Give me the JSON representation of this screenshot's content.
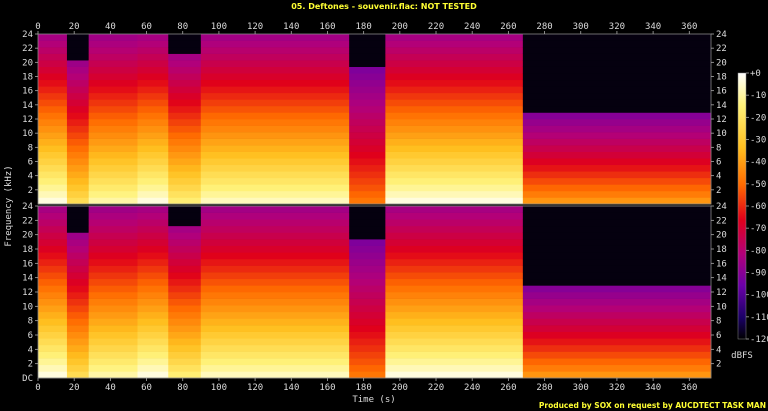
{
  "title": "05. Deftones - souvenir.flac: NOT TESTED",
  "credit": "Produced by SOX on request by AUCDTECT TASK MAN",
  "chart_data": {
    "type": "heatmap",
    "title": "05. Deftones - souvenir.flac: NOT TESTED",
    "xlabel": "Time (s)",
    "ylabel": "Frequency (kHz)",
    "xlim": [
      0,
      372
    ],
    "ylim": [
      0,
      24
    ],
    "x_ticks": [
      0,
      20,
      40,
      60,
      80,
      100,
      120,
      140,
      160,
      180,
      200,
      220,
      240,
      260,
      280,
      300,
      320,
      340,
      360
    ],
    "y_ticks": [
      2,
      4,
      6,
      8,
      10,
      12,
      14,
      16,
      18,
      20,
      22,
      24
    ],
    "y_tick_labels_left": [
      "DC",
      "2",
      "4",
      "6",
      "8",
      "10",
      "12",
      "14",
      "16",
      "18",
      "20",
      "22",
      "24"
    ],
    "channels": [
      "upper",
      "lower"
    ],
    "colorbar": {
      "label": "dBFS",
      "ticks": [
        "+0",
        "-10",
        "-20",
        "-30",
        "-40",
        "-50",
        "-60",
        "-70",
        "-80",
        "-90",
        "-100",
        "-110",
        "-120"
      ]
    },
    "segments": [
      {
        "start": 0,
        "end": 16,
        "cutoff_khz": 24,
        "level": 0.85
      },
      {
        "start": 16,
        "end": 28,
        "cutoff_khz": 21,
        "level": 0.7
      },
      {
        "start": 28,
        "end": 55,
        "cutoff_khz": 24,
        "level": 0.8
      },
      {
        "start": 55,
        "end": 72,
        "cutoff_khz": 24,
        "level": 0.85
      },
      {
        "start": 72,
        "end": 90,
        "cutoff_khz": 22,
        "level": 0.75
      },
      {
        "start": 90,
        "end": 172,
        "cutoff_khz": 24,
        "level": 0.82
      },
      {
        "start": 172,
        "end": 192,
        "cutoff_khz": 20,
        "level": 0.5
      },
      {
        "start": 192,
        "end": 268,
        "cutoff_khz": 24,
        "level": 0.85
      },
      {
        "start": 268,
        "end": 372,
        "cutoff_khz": 13,
        "level": 0.55
      }
    ]
  }
}
